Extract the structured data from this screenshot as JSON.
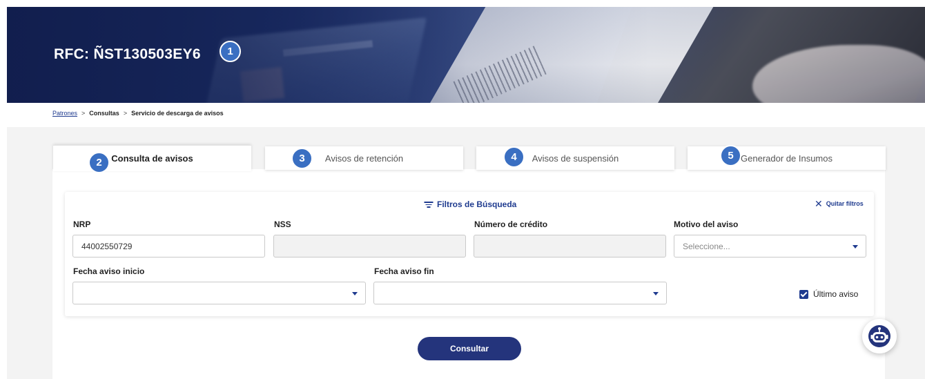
{
  "header": {
    "rfc_label": "RFC: ÑST130503EY6"
  },
  "badges": [
    "1",
    "2",
    "3",
    "4",
    "5"
  ],
  "breadcrumb": {
    "link": "Patrones",
    "separator": ">",
    "items": [
      "Consultas",
      "Servicio de descarga de avisos"
    ]
  },
  "tabs": [
    {
      "label": "Consulta de avisos",
      "active": true
    },
    {
      "label": "Avisos de retención",
      "active": false
    },
    {
      "label": "Avisos de suspensión",
      "active": false
    },
    {
      "label": "Generador de Insumos",
      "active": false
    }
  ],
  "filters": {
    "title": "Filtros de Búsqueda",
    "clear_label": "Quitar filtros",
    "nrp": {
      "label": "NRP",
      "value": "44002550729"
    },
    "nss": {
      "label": "NSS",
      "value": ""
    },
    "credito": {
      "label": "Número de crédito",
      "value": ""
    },
    "motivo": {
      "label": "Motivo del aviso",
      "placeholder": "Seleccione..."
    },
    "fecha_inicio": {
      "label": "Fecha aviso inicio",
      "value": ""
    },
    "fecha_fin": {
      "label": "Fecha aviso fin",
      "value": ""
    },
    "ultimo_aviso": {
      "label": "Último aviso",
      "checked": true
    }
  },
  "actions": {
    "consult_label": "Consultar"
  },
  "colors": {
    "primary": "#24347c",
    "link": "#1f3b8f",
    "badge": "#3a6fc2",
    "banner": "#152253"
  },
  "icons": [
    "filter-icon",
    "close-icon",
    "chevron-down-icon",
    "checkbox-checked-icon",
    "chatbot-icon"
  ]
}
